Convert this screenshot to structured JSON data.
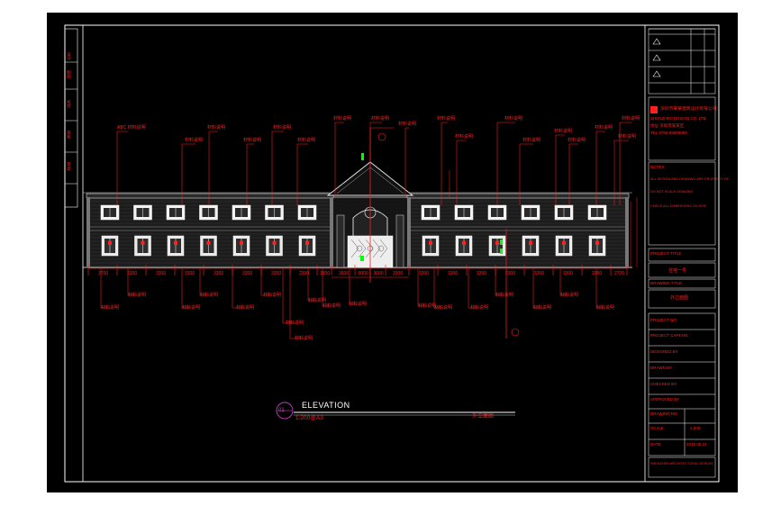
{
  "drawing": {
    "elevation_title": "ELEVATION",
    "elevation_number": "01",
    "scale": "1:200@A3",
    "elevation_cn": "外立面图"
  },
  "labels_top": [
    "ABC 材料说明",
    "材料说明",
    "材料说明",
    "材料说明",
    "材料说明",
    "材料说明",
    "材料说明",
    "材料说明",
    "材料说明",
    "材料说明",
    "材料说明",
    "材料说明",
    "材料说明",
    "材料说明",
    "材料说明",
    "材料说明",
    "材料说明",
    "材料说明"
  ],
  "labels_bottom": [
    "材料说明",
    "材料说明",
    "材料说明",
    "材料说明",
    "材料说明",
    "材料说明",
    "材料说明",
    "材料说明",
    "材料说明",
    "材料说明",
    "材料说明",
    "材料说明",
    "材料说明",
    "材料说明",
    "材料说明",
    "材料说明",
    "材料说明"
  ],
  "dimensions": [
    "2700",
    "3300",
    "3300",
    "3300",
    "3300",
    "3300",
    "3300",
    "3300",
    "3300",
    "3600",
    "6000",
    "3600",
    "3300",
    "3300",
    "3300",
    "3300",
    "3300",
    "3300",
    "3300",
    "3300",
    "2700"
  ],
  "title_block": {
    "company_lines": [
      "深圳市某某建筑设计有限公司",
      "SHENZHEN DESIGN CO. LTD",
      "地址 深圳市某某区",
      "TEL 0755-88888888"
    ],
    "notes": [
      "NOTES",
      "ALL DESIGN AND DRAWING ARE PROPERTY OF",
      "DO NOT SCALE DRAWING",
      "CHECK ALL DIMENSIONS ON SITE"
    ],
    "project_label": "PROJECT TITLE",
    "project_name": "住宅一号",
    "drawing_title_label": "DRAWING TITLE",
    "drawing_title": "外立面图",
    "fields": [
      "PROJECT NO.",
      "PROJECT CAPTAIN",
      "DESIGNED BY",
      "DRAWN BY",
      "CHECKED BY",
      "APPROVED BY",
      "DRAWING NO.",
      "SCALE",
      "DATE"
    ],
    "scale_value": "1:200",
    "date_value": "2019.08.23",
    "footer": "SHENZHEN ARCHITECTURAL DESIGN"
  },
  "left_strip": [
    "设计",
    "制图",
    "校对",
    "审核",
    "审定"
  ]
}
